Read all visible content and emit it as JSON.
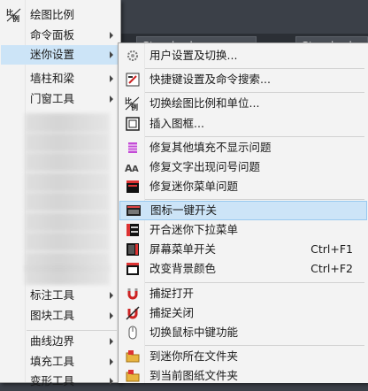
{
  "background": {
    "combo_left": "Standard",
    "combo_right": "Standard"
  },
  "left_menu": {
    "items": [
      {
        "label": "绘图比例",
        "icon": "scale-icon"
      },
      {
        "label": "命令面板"
      },
      {
        "label": "迷你设置"
      },
      {
        "label": "墙柱和梁"
      },
      {
        "label": "门窗工具"
      },
      {
        "label": "标注工具"
      },
      {
        "label": "图块工具"
      },
      {
        "label": "曲线边界"
      },
      {
        "label": "填充工具"
      },
      {
        "label": "变形工具"
      }
    ]
  },
  "right_menu": {
    "items": [
      {
        "label": "用户设置及切换...",
        "icon": "gear-icon"
      },
      {
        "label": "快捷键设置及命令搜索...",
        "icon": "edit-icon"
      },
      {
        "label": "切换绘图比例和单位...",
        "icon": "scale-icon"
      },
      {
        "label": "插入图框...",
        "icon": "frame-icon"
      },
      {
        "label": "修复其他填充不显示问题",
        "icon": "fill-icon"
      },
      {
        "label": "修复文字出现问号问题",
        "icon": "text-icon"
      },
      {
        "label": "修复迷你菜单问题",
        "icon": "menu-fix-icon"
      },
      {
        "label": "图标一键开关",
        "icon": "toolbar-icon"
      },
      {
        "label": "开合迷你下拉菜单",
        "icon": "dropdown-icon"
      },
      {
        "label": "屏幕菜单开关",
        "icon": "screen-menu-icon",
        "shortcut": "Ctrl+F1"
      },
      {
        "label": "改变背景颜色",
        "icon": "background-icon",
        "shortcut": "Ctrl+F2"
      },
      {
        "label": "捕捉打开",
        "icon": "magnet-on-icon"
      },
      {
        "label": "捕捉关闭",
        "icon": "magnet-off-icon"
      },
      {
        "label": "切换鼠标中键功能",
        "icon": "mouse-icon"
      },
      {
        "label": "到迷你所在文件夹",
        "icon": "folder-icon"
      },
      {
        "label": "到当前图纸文件夹",
        "icon": "folder-icon"
      }
    ]
  },
  "colors": {
    "highlight": "#cce4f7",
    "menu_bg": "#f3f3f3",
    "app_bg": "#3b4048"
  }
}
